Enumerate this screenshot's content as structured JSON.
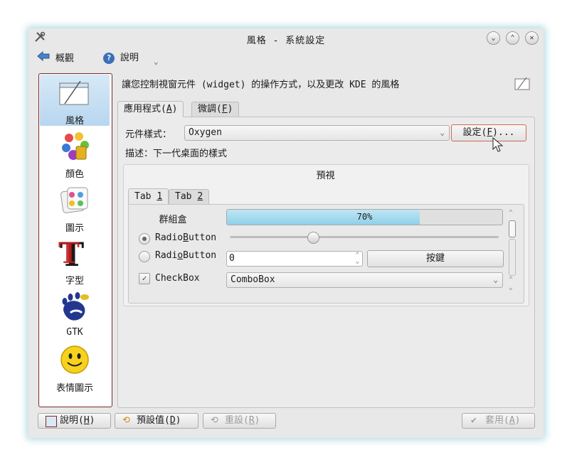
{
  "window": {
    "title": "風格 - 系統設定",
    "buttons": [
      "⌄",
      "⌃",
      "✕"
    ]
  },
  "toolbar": {
    "overview_label": "概觀",
    "help_label": "說明",
    "dropdown_glyph": "⌄"
  },
  "sidebar": {
    "items": [
      {
        "label": "風格",
        "icon": "style-icon",
        "selected": true
      },
      {
        "label": "顏色",
        "icon": "colors-icon"
      },
      {
        "label": "圖示",
        "icon": "icons-icon"
      },
      {
        "label": "字型",
        "icon": "fonts-icon"
      },
      {
        "label": "GTK",
        "icon": "gtk-icon"
      },
      {
        "label": "表情圖示",
        "icon": "emoticons-icon"
      }
    ]
  },
  "header": {
    "description": "讓您控制視窗元件 (widget) 的操作方式，以及更改 KDE 的風格"
  },
  "tabs": [
    {
      "label": "應用程式(",
      "key": "A",
      "suffix": ")"
    },
    {
      "label": "微調(",
      "key": "F",
      "suffix": ")"
    }
  ],
  "style": {
    "widget_style_label": "元件樣式：",
    "widget_style_value": "Oxygen",
    "configure_button": "設定(",
    "configure_key": "F",
    "configure_suffix": ")...",
    "description": "描述：下一代桌面的樣式"
  },
  "preview": {
    "title": "預視",
    "tab1_prefix": "Tab ",
    "tab1_key": "1",
    "tab2_prefix": "Tab ",
    "tab2_key": "2",
    "groupbox_title": "群組盒",
    "radio1_prefix": "Radio",
    "radio1_key": "B",
    "radio1_suffix": "utton",
    "radio2_prefix": "Radi",
    "radio2_key": "o",
    "radio2_suffix": "Button",
    "checkbox_label": "CheckBox",
    "progress_text": "70%",
    "progress_value": 0.7,
    "slider_value": 0.31,
    "spin_value": "0",
    "push_button": "按鍵",
    "combobox_value": "ComboBox"
  },
  "bottom": {
    "help_label": "說明(",
    "help_key": "H",
    "defaults_label": "預設值(",
    "defaults_key": "D",
    "reset_label": "重設(",
    "reset_key": "R",
    "apply_label": "套用(",
    "apply_key": "A",
    "close_paren": ")"
  },
  "colors": {
    "selection": "#b7d6ef",
    "progress": "#8fd0ea",
    "glow": "#78bec8"
  }
}
